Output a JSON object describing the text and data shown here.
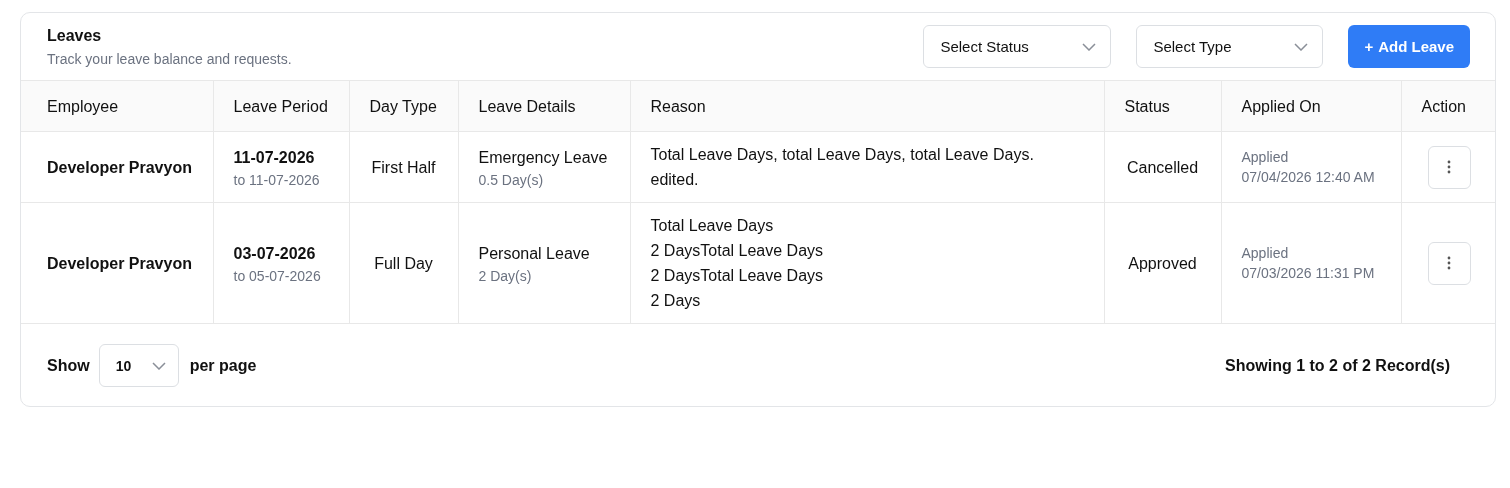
{
  "header": {
    "title": "Leaves",
    "subtitle": "Track your leave balance and requests."
  },
  "filters": [
    {
      "placeholder": "Select Status"
    },
    {
      "placeholder": "Select Type"
    }
  ],
  "add_button": {
    "icon": "+",
    "label": "Add Leave"
  },
  "table": {
    "columns": [
      "Employee",
      "Leave Period",
      "Day Type",
      "Leave Details",
      "Reason",
      "Status",
      "Applied On",
      "Action"
    ],
    "rows": [
      {
        "employee": "Developer Pravyon",
        "start": "11-07-2026",
        "end": "to 11-07-2026",
        "day_type": "First Half",
        "leave_type": "Emergency Leave",
        "days": "0.5 Day(s)",
        "reason": "Total Leave Days, total Leave Days, total Leave Days.\nedited.",
        "status": "Cancelled",
        "applied_label": "Applied",
        "applied_on": "07/04/2026 12:40 AM"
      },
      {
        "employee": "Developer Pravyon",
        "start": "03-07-2026",
        "end": "to 05-07-2026",
        "day_type": "Full Day",
        "leave_type": "Personal Leave",
        "days": "2 Day(s)",
        "reason": "Total Leave Days\n2 DaysTotal Leave Days\n2 DaysTotal Leave Days\n2 Days",
        "status": "Approved",
        "applied_label": "Applied",
        "applied_on": "07/03/2026 11:31 PM"
      }
    ]
  },
  "footer": {
    "show_label": "Show",
    "page_size": "10",
    "per_page_label": "per page",
    "summary": "Showing 1 to 2 of 2 Record(s)"
  }
}
